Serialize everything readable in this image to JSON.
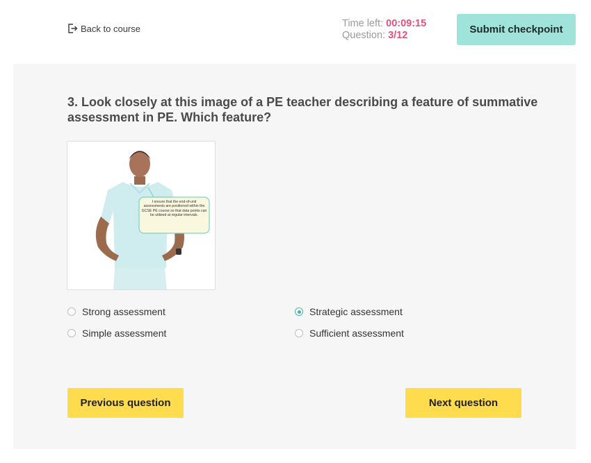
{
  "header": {
    "back_label": "Back to course",
    "time_label": "Time left:",
    "time_value": "00:09:15",
    "question_label": "Question:",
    "question_value": "3/12",
    "submit_label": "Submit checkpoint"
  },
  "question": {
    "text": "3.  Look closely at this image of a PE teacher describing a feature of summative assessment in PE. Which feature?",
    "speech_bubble": "I ensure that the end-of-unit assessments are positioned within the GCSE PE course so that data points can be utilised at regular intervals."
  },
  "options": [
    {
      "label": "Strong assessment",
      "selected": false
    },
    {
      "label": "Strategic assessment",
      "selected": true
    },
    {
      "label": "Simple assessment",
      "selected": false
    },
    {
      "label": "Sufficient assessment",
      "selected": false
    }
  ],
  "navigation": {
    "previous_label": "Previous question",
    "next_label": "Next question"
  },
  "colors": {
    "accent_teal": "#9fe3da",
    "radio_selected": "#3fb8a8",
    "timer_value": "#e0527a",
    "nav_button": "#fedc4d",
    "panel_bg": "#f6f6f6"
  }
}
